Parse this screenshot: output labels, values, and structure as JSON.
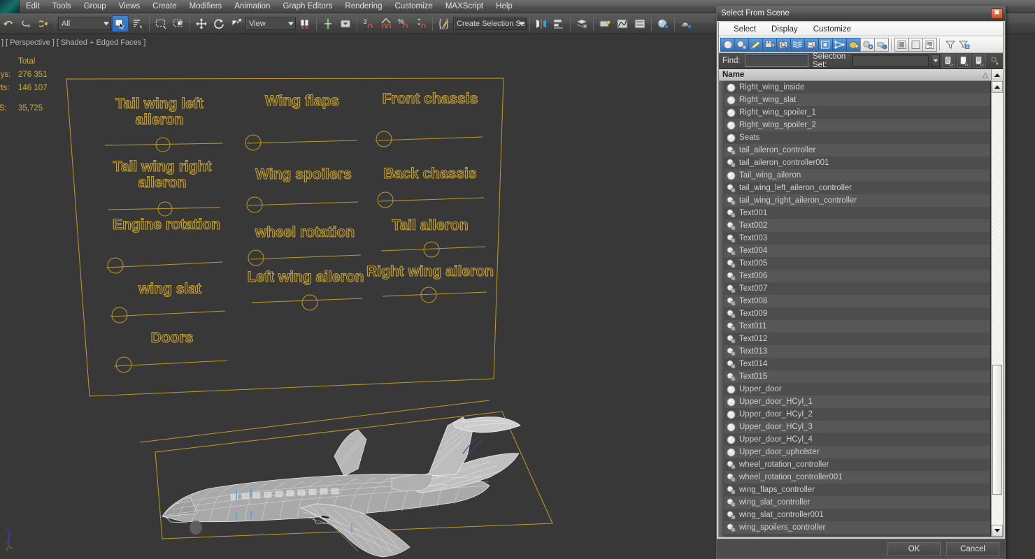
{
  "app": {
    "menu": [
      "Edit",
      "Tools",
      "Group",
      "Views",
      "Create",
      "Modifiers",
      "Animation",
      "Graph Editors",
      "Rendering",
      "Customize",
      "MAXScript",
      "Help"
    ],
    "logo_name": "3dsmax-logo"
  },
  "toolbar": {
    "selection_filter": "All",
    "reference_coord_system": "View",
    "named_selection_set": "Create Selection Se",
    "buttons": [
      {
        "name": "undo-button",
        "icon": "undo-arrow-icon"
      },
      {
        "name": "select-link-button",
        "icon": "link-icon"
      },
      {
        "name": "unlink-button",
        "icon": "unlink-icon"
      },
      {
        "name": "bind-to-space-warp-button",
        "icon": "space-warp-icon"
      },
      {
        "name": "select-object-button",
        "icon": "arrow-cursor-icon",
        "active": true
      },
      {
        "name": "select-by-name-button",
        "icon": "list-name-icon"
      },
      {
        "name": "rectangular-selection-region-button",
        "icon": "dashed-rect-icon"
      },
      {
        "name": "window-crossing-toggle-button",
        "icon": "window-crossing-icon"
      },
      {
        "name": "select-and-move-button",
        "icon": "move-gizmo-icon"
      },
      {
        "name": "select-and-rotate-button",
        "icon": "rotate-gizmo-icon"
      },
      {
        "name": "select-and-scale-button",
        "icon": "scale-gizmo-icon"
      },
      {
        "name": "use-center-flyout-button",
        "icon": "pivot-center-icon"
      },
      {
        "name": "select-and-manipulate-button",
        "icon": "manipulate-icon"
      },
      {
        "name": "snap-toggle-button",
        "icon": "snap-3-icon"
      },
      {
        "name": "angle-snap-toggle-button",
        "icon": "angle-snap-icon"
      },
      {
        "name": "percent-snap-toggle-button",
        "icon": "percent-snap-icon"
      },
      {
        "name": "spinner-snap-toggle-button",
        "icon": "spinner-snap-icon"
      },
      {
        "name": "edit-named-selection-sets-button",
        "icon": "named-set-icon"
      },
      {
        "name": "mirror-button",
        "icon": "mirror-icon"
      },
      {
        "name": "align-flyout-button",
        "icon": "align-icon"
      },
      {
        "name": "layer-manager-button",
        "icon": "layers-icon"
      },
      {
        "name": "toggle-scene-explorer-button",
        "icon": "scene-explorer-icon"
      },
      {
        "name": "curve-editor-button",
        "icon": "curve-editor-icon"
      },
      {
        "name": "schematic-view-button",
        "icon": "schematic-view-icon"
      },
      {
        "name": "material-editor-button",
        "icon": "material-editor-icon"
      },
      {
        "name": "render-setup-button",
        "icon": "teapot-render-icon"
      }
    ]
  },
  "viewport": {
    "label": "] [ Perspective ] [ Shaded + Edged Faces ]",
    "stats": {
      "header": "Total",
      "rows": [
        {
          "label": "Polys:",
          "value": "276 351"
        },
        {
          "label": "Verts:",
          "value": "146 107"
        },
        {
          "label": "FPS:",
          "value": "35,725"
        }
      ]
    },
    "axis": {
      "z": "Z",
      "x": "X",
      "y": "Y"
    },
    "scene_labels": [
      "Tail wing left aileron",
      "Tail wing right aileron",
      "Engine rotation",
      "wing slat",
      "Doors",
      "Wing flaps",
      "Wing spoilers",
      "wheel rotation",
      "Left wing aileron",
      "Front chassis",
      "Back chassis",
      "Tail aileron",
      "Right wing aileron"
    ],
    "wire_color": "#c29b20",
    "background_color": "#383838"
  },
  "dialog": {
    "title": "Select From Scene",
    "close_label": "✖",
    "menu": [
      "Select",
      "Display",
      "Customize"
    ],
    "toolbar_buttons": [
      {
        "name": "display-geometry-button",
        "icon": "sphere-icon",
        "on": true
      },
      {
        "name": "display-shapes-button",
        "icon": "shape-spline-icon",
        "on": true
      },
      {
        "name": "display-lights-button",
        "icon": "light-icon",
        "on": true
      },
      {
        "name": "display-cameras-button",
        "icon": "camera-icon",
        "on": true
      },
      {
        "name": "display-helpers-button",
        "icon": "helper-icon",
        "on": true
      },
      {
        "name": "display-space-warps-button",
        "icon": "space-warp-wave-icon",
        "on": true
      },
      {
        "name": "display-groups-button",
        "icon": "group-icon",
        "on": true
      },
      {
        "name": "display-xrefs-button",
        "icon": "xref-box-icon",
        "on": true
      },
      {
        "name": "display-bones-button",
        "icon": "bone-icon",
        "on": true
      },
      {
        "name": "display-containers-button",
        "icon": "container-icon",
        "on": true
      },
      {
        "name": "display-frozen-objects-button",
        "icon": "frozen-object-icon",
        "on": false
      },
      {
        "name": "display-hidden-objects-button",
        "icon": "hidden-object-icon",
        "on": false
      },
      {
        "name": "expand-all-button",
        "icon": "expand-list-icon",
        "on": false
      },
      {
        "name": "collapse-all-button",
        "icon": "collapse-panel-icon",
        "on": false
      },
      {
        "name": "display-children-button",
        "icon": "children-list-icon",
        "on": false
      },
      {
        "name": "filter-button",
        "icon": "funnel-icon",
        "on": false
      },
      {
        "name": "advanced-filter-button",
        "icon": "funnel-settings-icon",
        "on": false
      }
    ],
    "find": {
      "label": "Find:",
      "value": "",
      "placeholder": ""
    },
    "selection_set": {
      "label": "Selection Set:",
      "value": "",
      "placeholder": ""
    },
    "selset_buttons": [
      {
        "name": "select-objects-in-set-button",
        "icon": "doc-arrow-icon"
      },
      {
        "name": "add-to-set-button",
        "icon": "doc-plus-icon"
      },
      {
        "name": "remove-from-set-button",
        "icon": "doc-minus-icon"
      },
      {
        "name": "pin-stack-button",
        "icon": "pin-dropdown-icon"
      }
    ],
    "column_header": "Name",
    "sort_indicator": "△",
    "items": [
      {
        "name": "Right_wing_inside",
        "icon": "geometry-sphere-icon"
      },
      {
        "name": "Right_wing_slat",
        "icon": "geometry-sphere-icon"
      },
      {
        "name": "Right_wing_spoiler_1",
        "icon": "geometry-sphere-icon"
      },
      {
        "name": "Right_wing_spoiler_2",
        "icon": "geometry-sphere-icon"
      },
      {
        "name": "Seats",
        "icon": "geometry-sphere-icon"
      },
      {
        "name": "tail_aileron_controller",
        "icon": "shape-spline-icon"
      },
      {
        "name": "tail_aileron_controller001",
        "icon": "shape-spline-icon"
      },
      {
        "name": "Tail_wing_aileron",
        "icon": "geometry-sphere-icon"
      },
      {
        "name": "tail_wing_left_aileron_controller",
        "icon": "shape-spline-icon"
      },
      {
        "name": "tail_wing_right_aileron_controller",
        "icon": "shape-spline-icon"
      },
      {
        "name": "Text001",
        "icon": "shape-spline-icon"
      },
      {
        "name": "Text002",
        "icon": "shape-spline-icon"
      },
      {
        "name": "Text003",
        "icon": "shape-spline-icon"
      },
      {
        "name": "Text004",
        "icon": "shape-spline-icon"
      },
      {
        "name": "Text005",
        "icon": "shape-spline-icon"
      },
      {
        "name": "Text006",
        "icon": "shape-spline-icon"
      },
      {
        "name": "Text007",
        "icon": "shape-spline-icon"
      },
      {
        "name": "Text008",
        "icon": "shape-spline-icon"
      },
      {
        "name": "Text009",
        "icon": "shape-spline-icon"
      },
      {
        "name": "Text011",
        "icon": "shape-spline-icon"
      },
      {
        "name": "Text012",
        "icon": "shape-spline-icon"
      },
      {
        "name": "Text013",
        "icon": "shape-spline-icon"
      },
      {
        "name": "Text014",
        "icon": "shape-spline-icon"
      },
      {
        "name": "Text015",
        "icon": "shape-spline-icon"
      },
      {
        "name": "Upper_door",
        "icon": "geometry-sphere-icon"
      },
      {
        "name": "Upper_door_HCyl_1",
        "icon": "geometry-sphere-icon"
      },
      {
        "name": "Upper_door_HCyl_2",
        "icon": "geometry-sphere-icon"
      },
      {
        "name": "Upper_door_HCyl_3",
        "icon": "geometry-sphere-icon"
      },
      {
        "name": "Upper_door_HCyl_4",
        "icon": "geometry-sphere-icon"
      },
      {
        "name": "Upper_door_upholster",
        "icon": "geometry-sphere-icon"
      },
      {
        "name": "wheel_rotation_controller",
        "icon": "shape-spline-icon"
      },
      {
        "name": "wheel_rotation_controller001",
        "icon": "shape-spline-icon"
      },
      {
        "name": "wing_flaps_controller",
        "icon": "shape-spline-icon"
      },
      {
        "name": "wing_slat_controller",
        "icon": "shape-spline-icon"
      },
      {
        "name": "wing_slat_controller001",
        "icon": "shape-spline-icon"
      },
      {
        "name": "wing_spoilers_controller",
        "icon": "shape-spline-icon"
      }
    ],
    "scrollbar": {
      "thumb_top_pct": 63,
      "thumb_height_pct": 30
    },
    "ok_label": "OK",
    "cancel_label": "Cancel"
  }
}
